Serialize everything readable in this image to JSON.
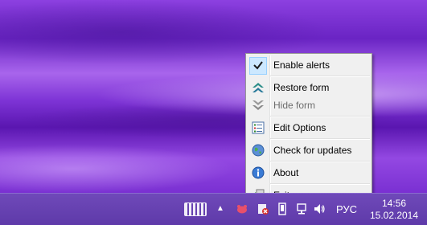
{
  "menu": {
    "items": [
      {
        "label": "Enable alerts",
        "icon": "checkmark-icon",
        "checked": true,
        "enabled": true
      },
      {
        "label": "Restore form",
        "icon": "double-chevron-up-icon",
        "enabled": true
      },
      {
        "label": "Hide form",
        "icon": "double-chevron-down-icon",
        "enabled": false
      },
      {
        "label": "Edit Options",
        "icon": "options-list-icon",
        "enabled": true
      },
      {
        "label": "Check for updates",
        "icon": "globe-update-icon",
        "enabled": true
      },
      {
        "label": "About",
        "icon": "info-icon",
        "enabled": true
      },
      {
        "label": "Exit",
        "icon": "exit-icon",
        "enabled": true
      }
    ]
  },
  "taskbar": {
    "language": "РУС",
    "time": "14:56",
    "date": "15.02.2014",
    "tray_icons": [
      "app-tray-icon",
      "network-error-icon",
      "device-icon",
      "network-icon",
      "volume-icon"
    ]
  },
  "colors": {
    "accent": "#7b2fd6",
    "taskbar": "#6244ae",
    "menu_bg": "#f0f0f0",
    "highlight": "#cce8ff"
  }
}
